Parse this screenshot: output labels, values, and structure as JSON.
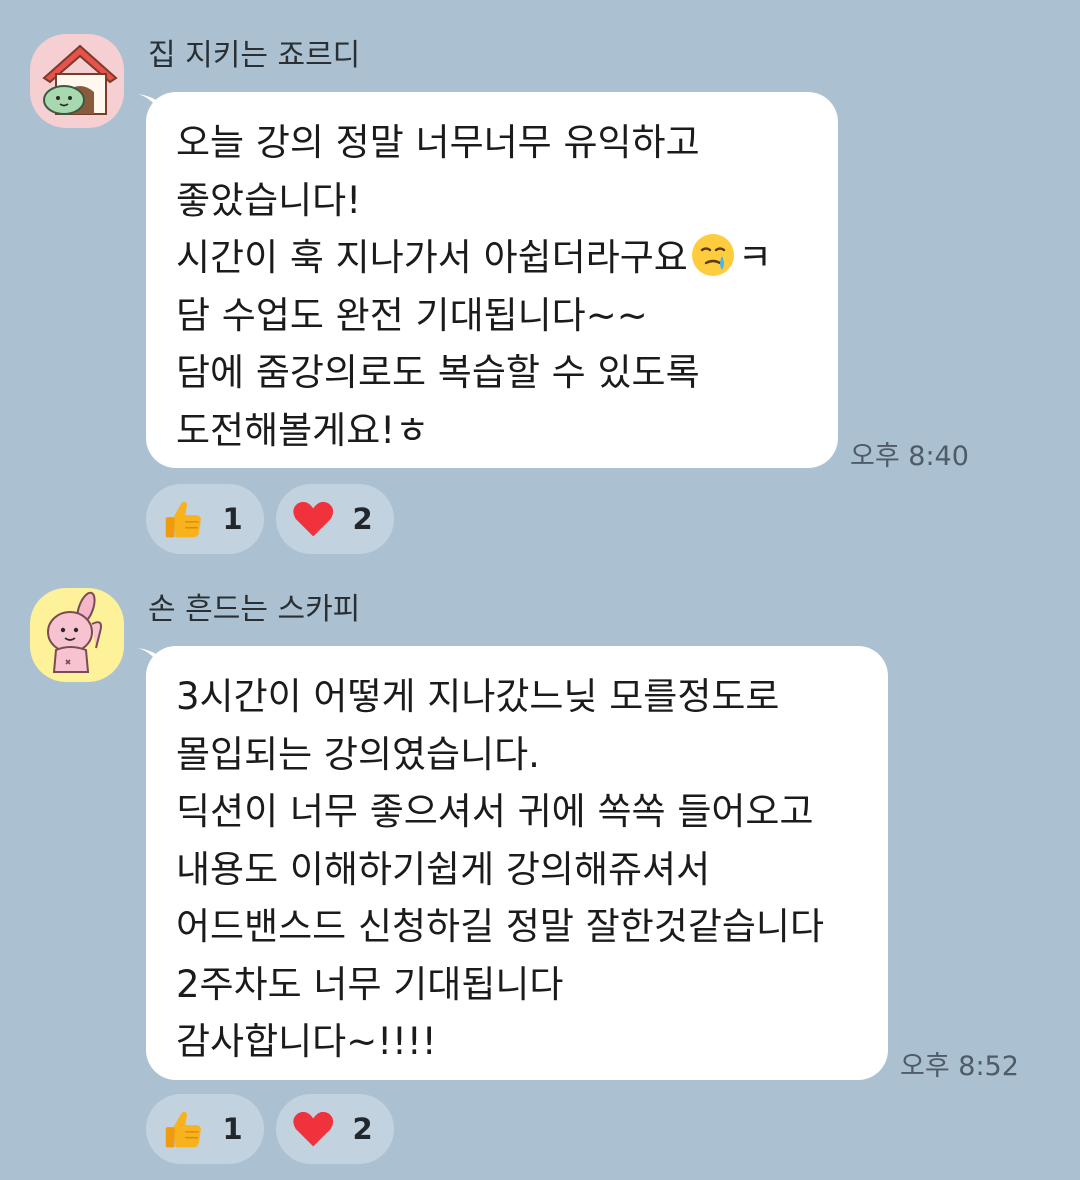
{
  "messages": [
    {
      "sender": "집 지키는 죠르디",
      "avatar_icon": "jordy-doghouse-avatar-icon",
      "lines": [
        "오늘 강의 정말 너무너무 유익하고",
        "좋았습니다!",
        "시간이 훅 지나가서 아쉽더라구요",
        "담 수업도 완전 기대됩니다~~",
        "담에 줌강의로도 복습할 수 있도록",
        "도전해볼게요!ㅎ"
      ],
      "line3_suffix": "ㅋ",
      "inline_emoji": "crying-face-emoji-icon",
      "time": "오후 8:40",
      "reactions": [
        {
          "icon": "thumbs-up-icon",
          "count": "1"
        },
        {
          "icon": "heart-icon",
          "count": "2"
        }
      ]
    },
    {
      "sender": "손 흔드는 스카피",
      "avatar_icon": "scappy-waving-avatar-icon",
      "lines": [
        "3시간이 어떻게 지나갔느닞 모를정도로",
        "몰입되는 강의였습니다.",
        "딕션이 너무 좋으셔서 귀에 쏙쏙 들어오고",
        "내용도 이해하기쉽게 강의해쥬셔서",
        "어드밴스드 신청하길 정말 잘한것같습니다",
        "2주차도 너무 기대됩니다",
        "감사합니다~!!!!"
      ],
      "time": "오후 8:52",
      "reactions": [
        {
          "icon": "thumbs-up-icon",
          "count": "1"
        },
        {
          "icon": "heart-icon",
          "count": "2"
        }
      ]
    }
  ],
  "colors": {
    "background": "#abc1d1",
    "bubble": "#ffffff",
    "heart": "#f0323c",
    "thumb": "#f7b21e"
  }
}
